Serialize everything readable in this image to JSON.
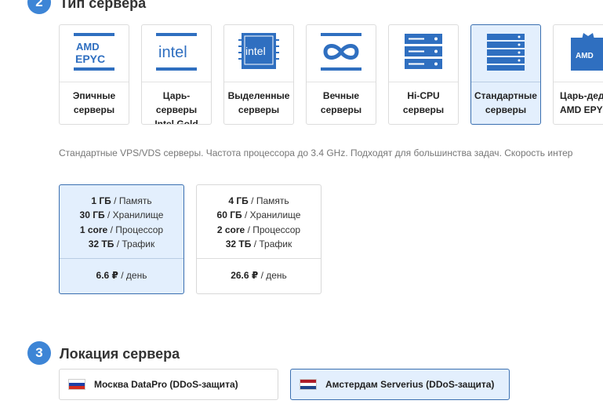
{
  "section_server_type": {
    "step": "2",
    "title": "Тип сервера",
    "cards": [
      {
        "id": "epyc",
        "label": "Эпичные\nсерверы",
        "icon": "amd-epyc-logo-icon",
        "selected": false
      },
      {
        "id": "intel-gold",
        "label": "Царь-серверы\nIntel Gold",
        "icon": "intel-logo-icon",
        "selected": false
      },
      {
        "id": "dedicated",
        "label": "Выделенные\nсерверы",
        "icon": "intel-chip-icon",
        "selected": false
      },
      {
        "id": "eternal",
        "label": "Вечные\nсерверы",
        "icon": "infinity-icon",
        "selected": false
      },
      {
        "id": "hi-cpu",
        "label": "Hi-CPU\nсерверы",
        "icon": "server-stack-icon",
        "selected": false
      },
      {
        "id": "standard",
        "label": "Стандартные\nсерверы",
        "icon": "server-rack-icon",
        "selected": true
      },
      {
        "id": "amd-epyc-dedicated",
        "label": "Царь-деди\nAMD EPY",
        "icon": "amd-crown-icon",
        "selected": false
      }
    ],
    "icon_text": {
      "amd": "AMD",
      "epyc": "EPYC",
      "intel": "intel",
      "intel_chip": "intel",
      "amd_small": "AMD"
    },
    "description": "Стандартные VPS/VDS серверы. Частота процессора до 3.4 GHz. Подходят для большинства задач. Скорость интер"
  },
  "plans": [
    {
      "selected": true,
      "memory_value": "1 ГБ",
      "memory_label": " / Память",
      "storage_value": "30 ГБ",
      "storage_label": " / Хранилище",
      "cpu_value": "1 core",
      "cpu_label": " / Процессор",
      "traffic_value": "32 ТБ",
      "traffic_label": " / Трафик",
      "price_value": "6.6 ₽",
      "price_label": " / день"
    },
    {
      "selected": false,
      "memory_value": "4 ГБ",
      "memory_label": " / Память",
      "storage_value": "60 ГБ",
      "storage_label": " / Хранилище",
      "cpu_value": "2 core",
      "cpu_label": " / Процессор",
      "traffic_value": "32 ТБ",
      "traffic_label": " / Трафик",
      "price_value": "26.6 ₽",
      "price_label": " / день"
    }
  ],
  "section_location": {
    "step": "3",
    "title": "Локация сервера",
    "locations": [
      {
        "label": "Москва DataPro (DDoS-защита)",
        "flag": [
          "#ffffff",
          "#1c3fa8",
          "#d52b1e"
        ],
        "selected": false
      },
      {
        "label": "Амстердам Serverius (DDoS-защита)",
        "flag": [
          "#ae1c28",
          "#ffffff",
          "#21468b"
        ],
        "selected": true
      }
    ]
  },
  "colors": {
    "accent": "#3d85d6",
    "icon_blue": "#2f6fc0",
    "selected_bg": "#e3effd",
    "selected_border": "#3a6fb0"
  }
}
